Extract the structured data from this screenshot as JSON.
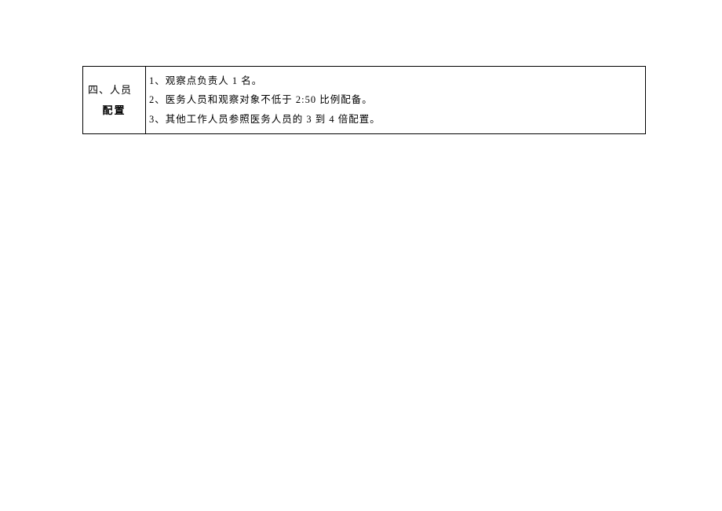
{
  "table": {
    "left": {
      "line1": "四、人员",
      "line2": "配置"
    },
    "right": {
      "item1": "1、观察点负责人 1 名。",
      "item2": "2、医务人员和观察对象不低于 2:50 比例配备。",
      "item3": "3、其他工作人员参照医务人员的 3 到 4 倍配置。"
    }
  }
}
